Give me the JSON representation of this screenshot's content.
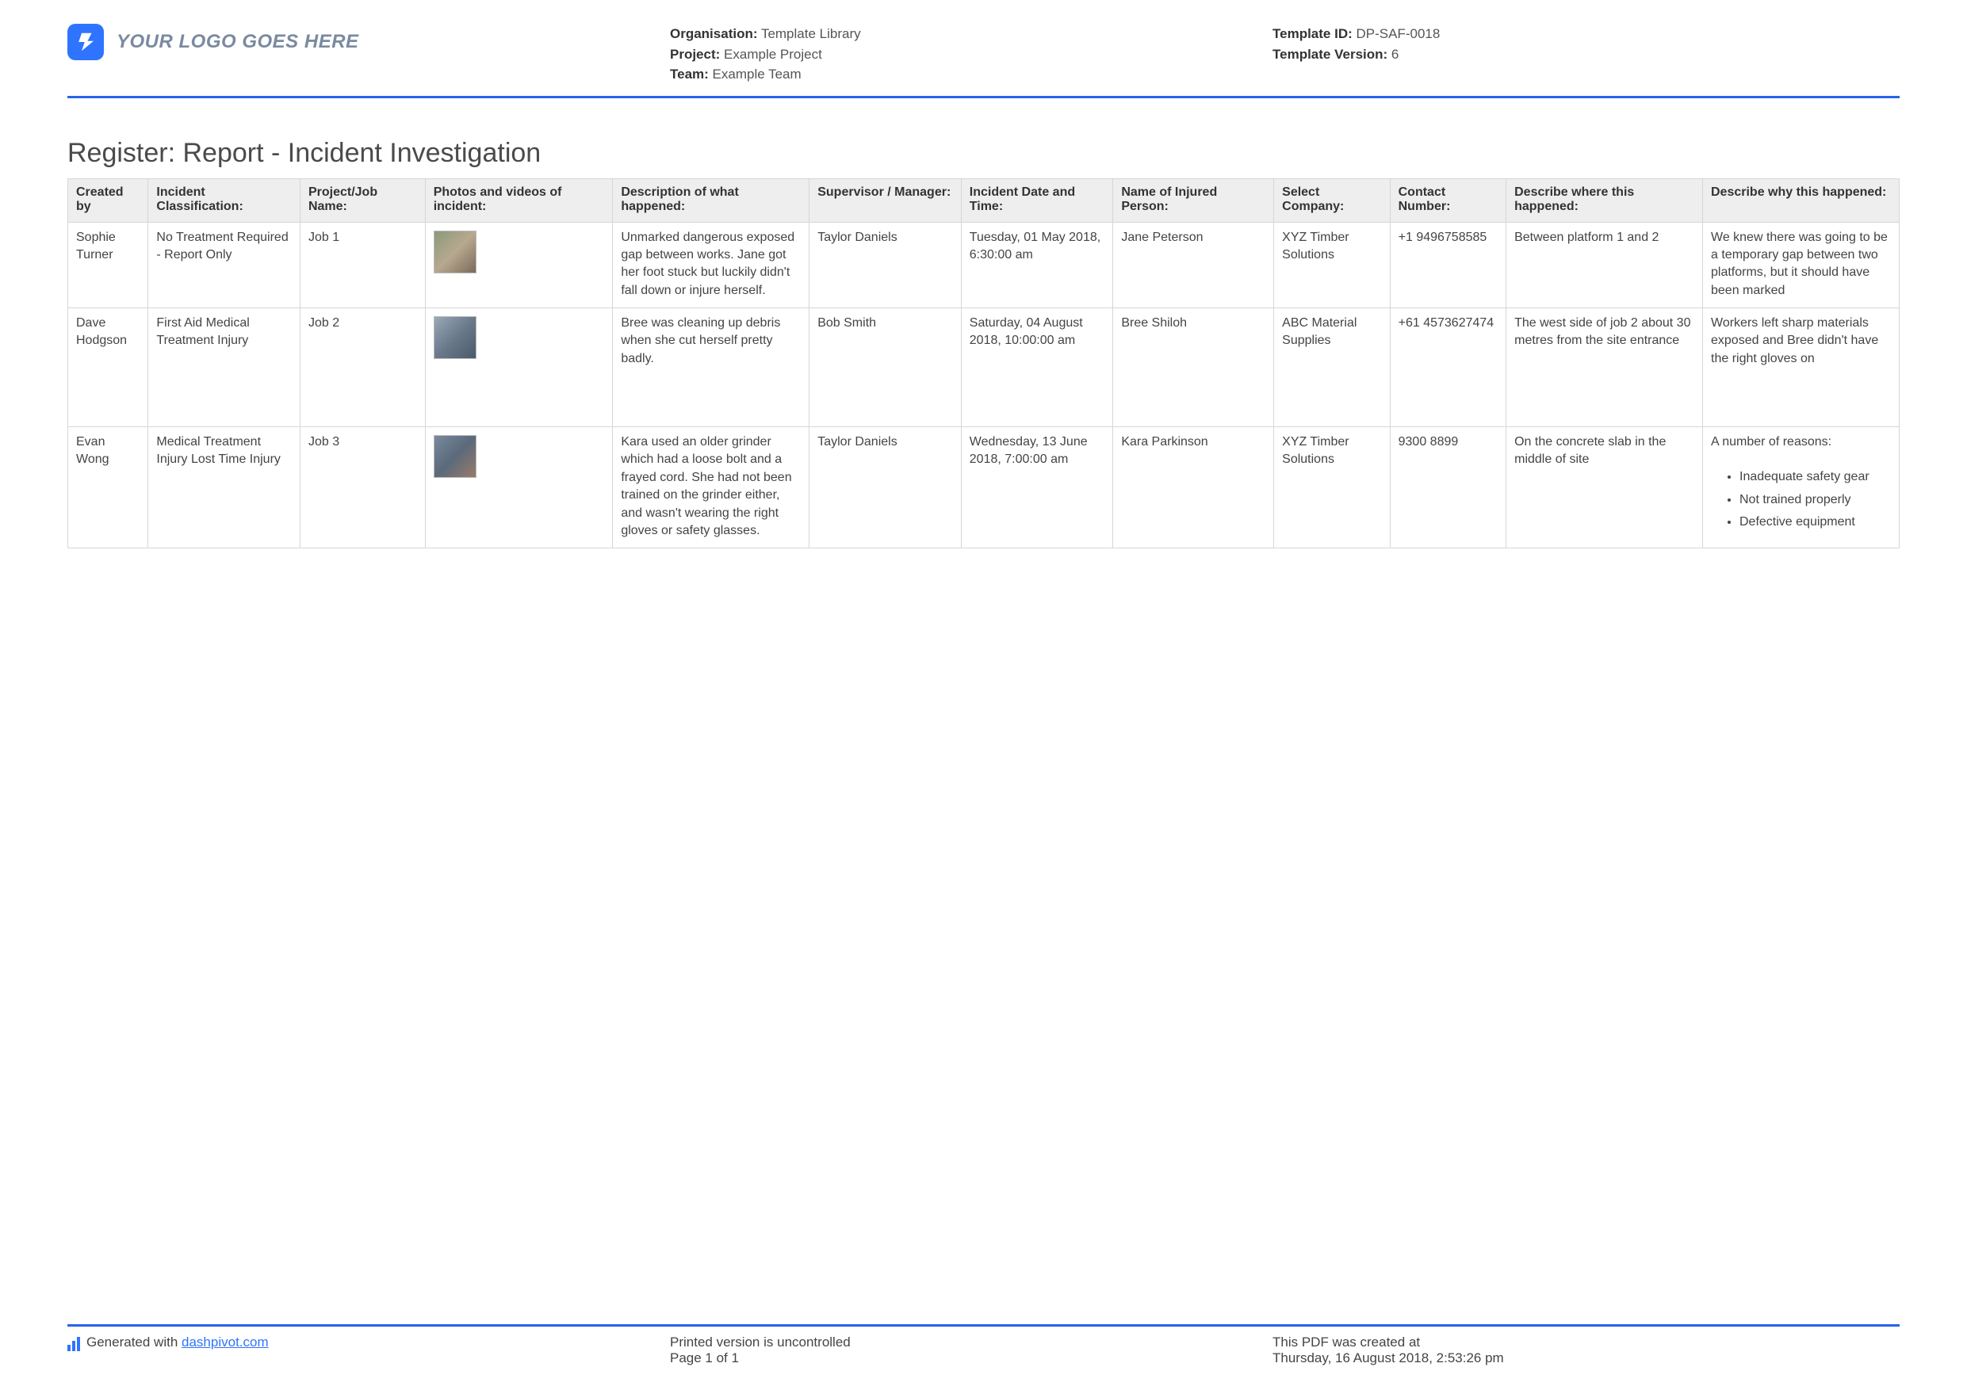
{
  "header": {
    "logo_text": "YOUR LOGO GOES HERE",
    "org_label": "Organisation:",
    "org_value": "Template Library",
    "project_label": "Project:",
    "project_value": "Example Project",
    "team_label": "Team:",
    "team_value": "Example Team",
    "template_id_label": "Template ID:",
    "template_id_value": "DP-SAF-0018",
    "template_ver_label": "Template Version:",
    "template_ver_value": "6"
  },
  "title": "Register: Report - Incident Investigation",
  "columns": {
    "c1": "Created by",
    "c2": "Incident Classification:",
    "c3": "Project/Job Name:",
    "c4": "Photos and videos of incident:",
    "c5": "Description of what happened:",
    "c6": "Supervisor / Manager:",
    "c7": "Incident Date and Time:",
    "c8": "Name of Injured Person:",
    "c9": "Select Company:",
    "c10": "Contact Number:",
    "c11": "Describe where this happened:",
    "c12": "Describe why this happened:"
  },
  "rows": [
    {
      "created_by": "Sophie Turner",
      "classification": "No Treatment Required - Report Only",
      "job": "Job 1",
      "photo_icon": "thumbnail",
      "description": "Unmarked dangerous exposed gap between works. Jane got her foot stuck but luckily didn't fall down or injure herself.",
      "supervisor": "Taylor Daniels",
      "datetime": "Tuesday, 01 May 2018, 6:30:00 am",
      "injured": "Jane Peterson",
      "company": "XYZ Timber Solutions",
      "contact": "+1 9496758585",
      "where": "Between platform 1 and 2",
      "why": "We knew there was going to be a temporary gap between two platforms, but it should have been marked"
    },
    {
      "created_by": "Dave Hodgson",
      "classification": "First Aid   Medical Treatment Injury",
      "job": "Job 2",
      "photo_icon": "thumbnail",
      "description": "Bree was cleaning up debris when she cut herself pretty badly.",
      "supervisor": "Bob Smith",
      "datetime": "Saturday, 04 August 2018, 10:00:00 am",
      "injured": "Bree Shiloh",
      "company": "ABC Material Supplies",
      "contact": "+61 4573627474",
      "where": "The west side of job 2 about 30 metres from the site entrance",
      "why": "Workers left sharp materials exposed and Bree didn't have the right gloves on"
    },
    {
      "created_by": "Evan Wong",
      "classification": "Medical Treatment Injury   Lost Time Injury",
      "job": "Job 3",
      "photo_icon": "thumbnail",
      "description": "Kara used an older grinder which had a loose bolt and a frayed cord. She had not been trained on the grinder either, and wasn't wearing the right gloves or safety glasses.",
      "supervisor": "Taylor Daniels",
      "datetime": "Wednesday, 13 June 2018, 7:00:00 am",
      "injured": "Kara Parkinson",
      "company": "XYZ Timber Solutions",
      "contact": "9300 8899",
      "where": "On the concrete slab in the middle of site",
      "why_intro": "A number of reasons:",
      "why_list": [
        "Inadequate safety gear",
        "Not trained properly",
        "Defective equipment"
      ]
    }
  ],
  "footer": {
    "gen_prefix": "Generated with ",
    "gen_link": "dashpivot.com",
    "mid_line1": "Printed version is uncontrolled",
    "mid_line2": "Page 1 of 1",
    "right_line1": "This PDF was created at",
    "right_line2": "Thursday, 16 August 2018, 2:53:26 pm"
  }
}
